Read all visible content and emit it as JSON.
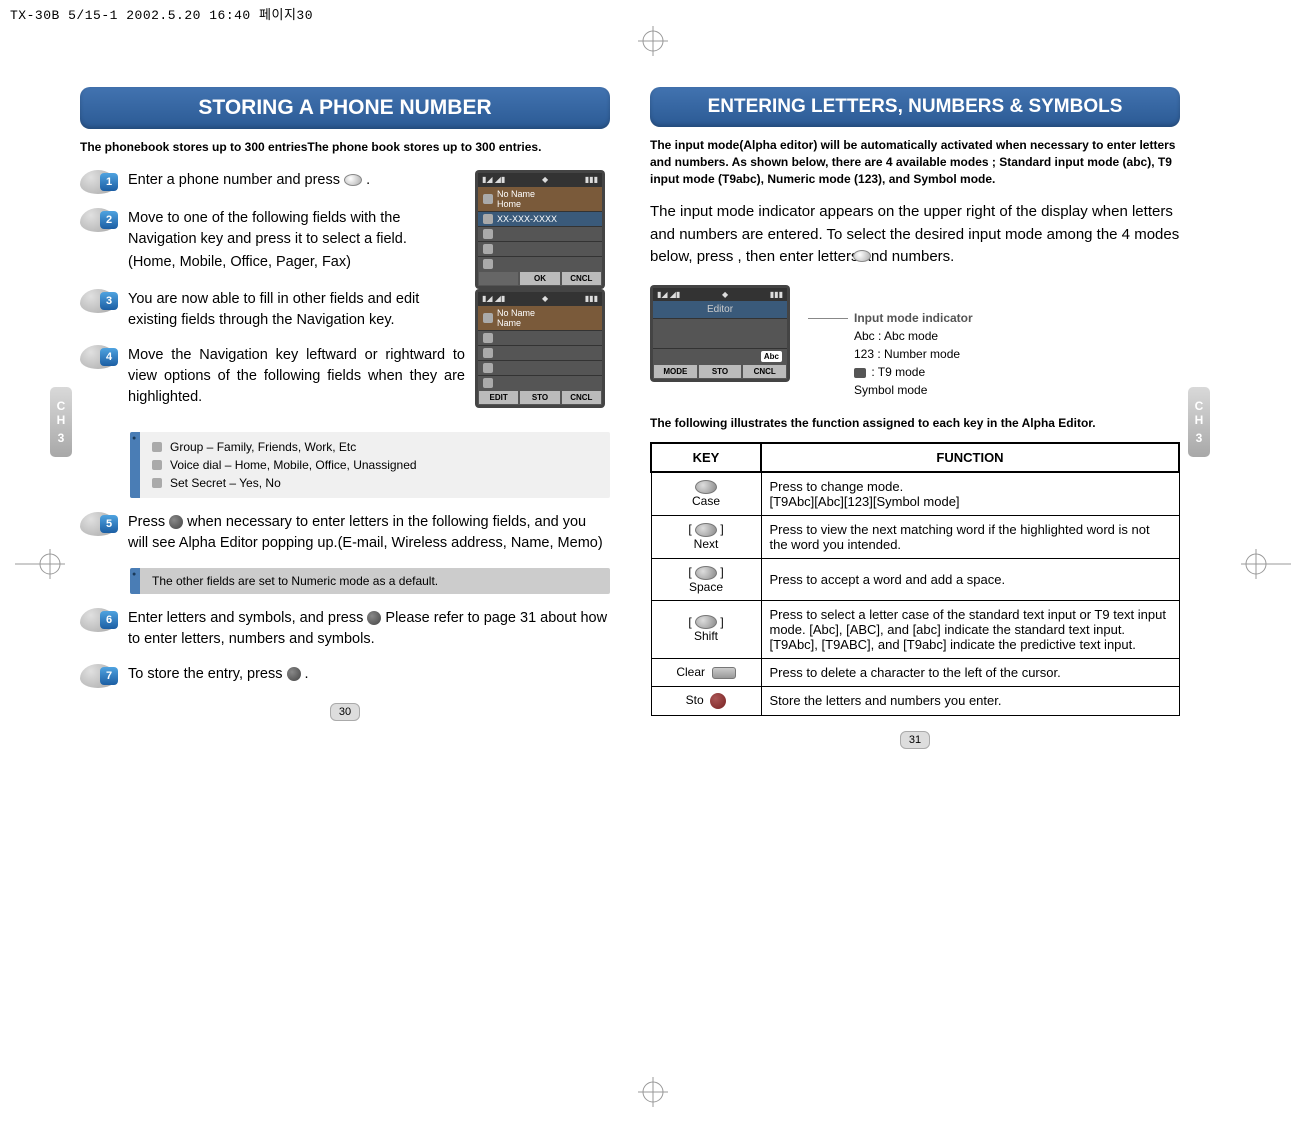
{
  "header": "TX-30B 5/15-1  2002.5.20 16:40 페이지30",
  "chapter_label_lines": [
    "C",
    "H",
    "3"
  ],
  "left": {
    "title": "STORING A PHONE NUMBER",
    "intro": "The phonebook stores up to 300 entriesThe phone book stores up to 300 entries.",
    "steps": {
      "s1": {
        "num": "1",
        "text": "Enter a phone number and press",
        "iconAfter": "."
      },
      "s2": {
        "num": "2",
        "text": "Move to one of the following fields with the Navigation key and press it to select a field.",
        "sub": "(Home, Mobile, Office, Pager, Fax)"
      },
      "s3": {
        "num": "3",
        "text": "You are now able to fill in other fields and edit existing fields through the Navigation key."
      },
      "s4": {
        "num": "4",
        "text": "Move the Navigation key leftward or rightward to view options of the following fields when they are highlighted."
      },
      "s5": {
        "num": "5",
        "text_a": "Press",
        "text_b": "when necessary to enter letters in the following fields, and you will see Alpha Editor popping up.(E-mail, Wireless address, Name, Memo)"
      },
      "s6": {
        "num": "6",
        "text_a": "Enter letters and symbols, and press",
        "text_b": "Please refer to page 31 about how to enter letters, numbers and symbols."
      },
      "s7": {
        "num": "7",
        "text_a": "To store the entry, press",
        "text_b": "."
      }
    },
    "bullets": {
      "group": "Group – Family, Friends, Work, Etc",
      "voice": "Voice dial – Home, Mobile, Office, Unassigned",
      "secret": "Set Secret – Yes, No"
    },
    "note": "The other fields are set to Numeric mode as a default.",
    "screen1": {
      "name_label": "No Name",
      "field": "Home",
      "value": "XX-XXX-XXXX",
      "sk_ok": "OK",
      "sk_cncl": "CNCL"
    },
    "screen2": {
      "name_label": "No Name",
      "field": "Name",
      "sk_edit": "EDIT",
      "sk_sto": "STO",
      "sk_cncl": "CNCL"
    },
    "page_num": "30"
  },
  "right": {
    "title": "ENTERING LETTERS, NUMBERS & SYMBOLS",
    "intro": "The input mode(Alpha editor) will be automatically activated when necessary to enter letters and numbers. As shown below, there are 4 available modes ; Standard input mode (abc), T9 input mode (T9abc), Numeric mode (123), and Symbol mode.",
    "body": "The input mode indicator appears on the upper right of the display when letters and numbers are entered. To select the desired input mode among the 4 modes below, press          , then enter letters and numbers.",
    "editor_screen": {
      "title": "Editor",
      "badge": "Abc",
      "sk_mode": "MODE",
      "sk_sto": "STO",
      "sk_cncl": "CNCL"
    },
    "indicator": {
      "heading": "Input mode indicator",
      "abc": "Abc : Abc mode",
      "num": "123 : Number mode",
      "t9": " : T9 mode",
      "sym": "Symbol mode"
    },
    "func_intro": "The following illustrates the function assigned to each key in the Alpha Editor.",
    "table": {
      "h_key": "KEY",
      "h_func": "FUNCTION",
      "rows": {
        "case": {
          "key": "Case",
          "func": "Press to change mode.\n[T9Abc][Abc][123][Symbol mode]"
        },
        "next": {
          "key": "Next",
          "func": "Press to view the next matching word if the highlighted word is not the word you intended."
        },
        "space": {
          "key": "Space",
          "func": "Press to accept a word and add a space."
        },
        "shift": {
          "key": "Shift",
          "func": "Press to select a letter case of the standard text input or T9  text input mode. [Abc], [ABC], and [abc] indicate the standard text input.\n[T9Abc], [T9ABC], and [T9abc] indicate the predictive text input."
        },
        "clear": {
          "key": "Clear",
          "func": "Press to delete a character to the left of the cursor."
        },
        "sto": {
          "key": "Sto",
          "func": "Store the letters and numbers you enter."
        }
      }
    },
    "page_num": "31"
  }
}
